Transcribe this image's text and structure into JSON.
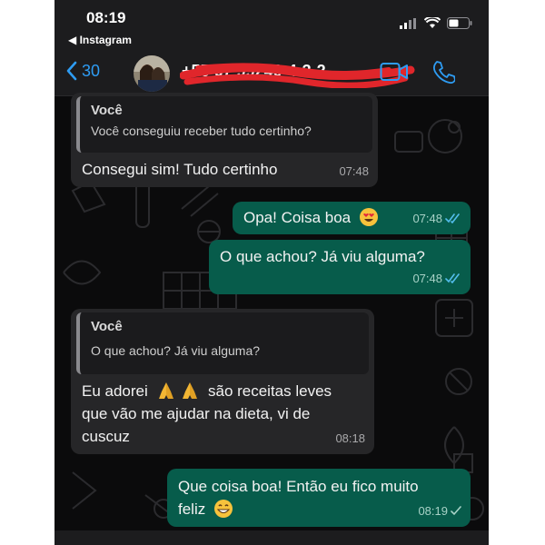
{
  "status_bar": {
    "time": "08:19",
    "back_app": "Instagram"
  },
  "header": {
    "back_count": "30",
    "contact_name": "+55 67 99240-4-3-2"
  },
  "messages": [
    {
      "quote_author": "Você",
      "quote_text": "Você conseguiu receber tudo certinho?",
      "text": "Consegui sim! Tudo certinho",
      "time": "07:48"
    },
    {
      "text": "Opa! Coisa boa",
      "time": "07:48",
      "status": "read"
    },
    {
      "text": "O que achou? Já viu alguma?",
      "time": "07:48",
      "status": "read"
    },
    {
      "quote_author": "Você",
      "quote_text": "O que achou? Já viu alguma?",
      "text_before": "Eu adorei",
      "text_after": "são receitas leves",
      "line2": "que vão me ajudar na dieta, vi de",
      "line3": "cuscuz",
      "time": "08:18"
    },
    {
      "line1": "Que coisa boa! Então eu fico muito",
      "line2": "feliz",
      "time": "08:19",
      "status": "sent"
    }
  ],
  "colors": {
    "incoming": "#262628",
    "outgoing": "#075c4b",
    "accent": "#2e9cf3",
    "read_ticks": "#53bdeb"
  },
  "icons": [
    "back-chevron",
    "video-camera",
    "phone",
    "heart-eyes-emoji",
    "folded-hands-emoji",
    "grinning-emoji",
    "double-check",
    "single-check",
    "signal",
    "wifi",
    "battery"
  ]
}
